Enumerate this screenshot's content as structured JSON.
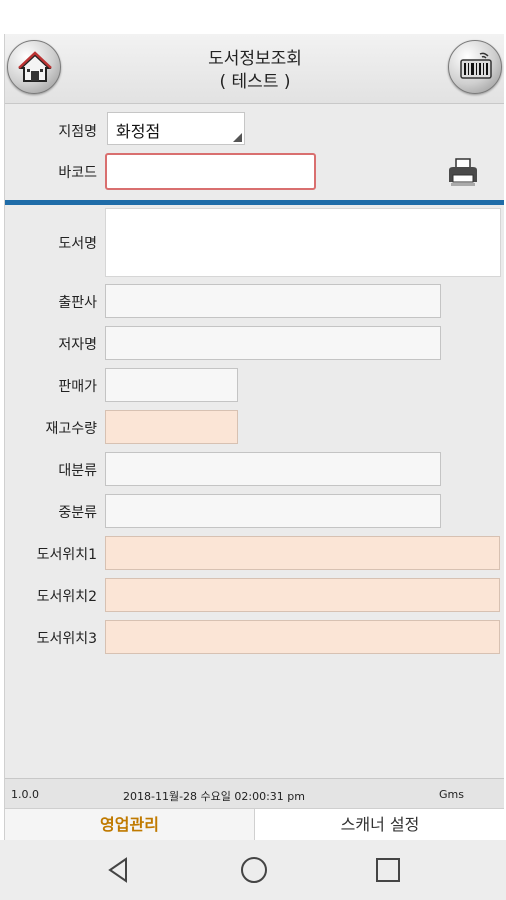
{
  "header": {
    "title_line1": "도서정보조회",
    "title_line2": "( 테스트 )",
    "home_icon": "home-icon",
    "scan_icon": "barcode-scanner-icon"
  },
  "form": {
    "branch_label": "지점명",
    "branch_value": "화정점",
    "barcode_label": "바코드",
    "barcode_value": "",
    "print_icon": "printer-icon",
    "book_title_label": "도서명",
    "publisher_label": "출판사",
    "author_label": "저자명",
    "price_label": "판매가",
    "stock_label": "재고수량",
    "major_category_label": "대분류",
    "middle_category_label": "중분류",
    "location1_label": "도서위치1",
    "location2_label": "도서위치2",
    "location3_label": "도서위치3"
  },
  "status": {
    "version": "1.0.0",
    "datetime": "2018-11월-28 수요일 02:00:31 pm",
    "user": "Gms"
  },
  "tabs": {
    "sales_label": "영업관리",
    "scanner_label": "스캐너 설정"
  },
  "navbar": {
    "back_icon": "back-triangle-icon",
    "home_icon": "home-circle-icon",
    "recent_icon": "recent-apps-square-icon"
  },
  "colors": {
    "accent_divider": "#1f6ca8",
    "active_tab": "#c07a00",
    "peach_field": "#fbe5d6",
    "barcode_border": "#d96f6f"
  }
}
